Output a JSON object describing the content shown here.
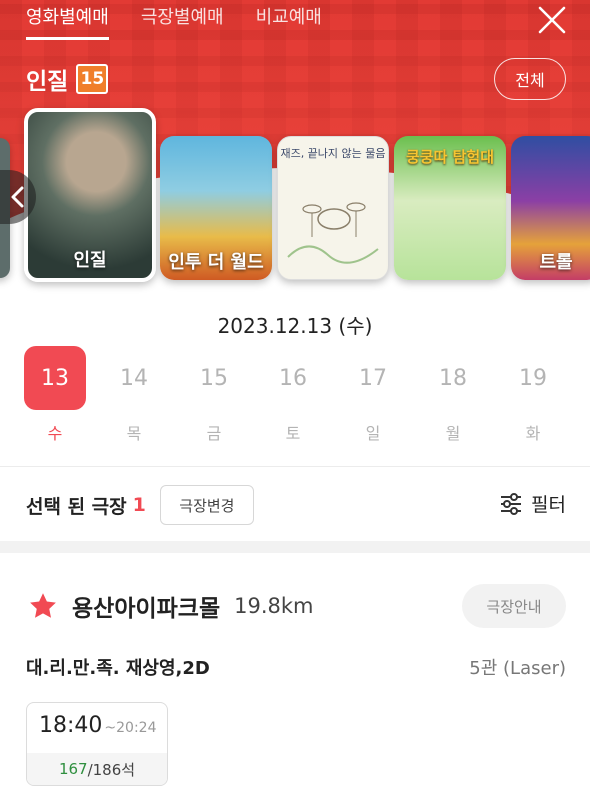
{
  "nav": {
    "tabs": [
      "영화별예매",
      "극장별예매",
      "비교예매"
    ],
    "active_tab": 0
  },
  "movie": {
    "title": "인질",
    "rating": "15",
    "all_button": "전체"
  },
  "posters": [
    {
      "caption": ""
    },
    {
      "caption": "인질"
    },
    {
      "caption": "인투 더 월드"
    },
    {
      "caption": "재즈, 끝나지 않는 물음"
    },
    {
      "caption": "쿵쿵따 탐험대"
    },
    {
      "caption": "트롤"
    }
  ],
  "date": {
    "selected_label": "2023.12.13 (수)",
    "days": [
      {
        "num": "13",
        "dow": "수"
      },
      {
        "num": "14",
        "dow": "목"
      },
      {
        "num": "15",
        "dow": "금"
      },
      {
        "num": "16",
        "dow": "토"
      },
      {
        "num": "17",
        "dow": "일"
      },
      {
        "num": "18",
        "dow": "월"
      },
      {
        "num": "19",
        "dow": "화"
      }
    ]
  },
  "theater_select": {
    "label": "선택 된 극장",
    "count": "1",
    "change_button": "극장변경",
    "filter_label": "필터"
  },
  "cinema": {
    "name": "용산아이파크몰",
    "distance": "19.8km",
    "info_button": "극장안내"
  },
  "showing": {
    "movie_name": "대.리.만.족. 재상영,2D",
    "screen": "5관 (Laser)",
    "slots": [
      {
        "start": "18:40",
        "end": "~20:24",
        "available": "167",
        "total": "/186석"
      }
    ]
  },
  "colors": {
    "header_red": "#e23a34",
    "accent": "#f14a53",
    "rating_orange": "#f07e2b",
    "seats_green": "#2f8f3f"
  },
  "icons": [
    "close-icon",
    "chevron-left-icon",
    "filter-icon",
    "star-icon"
  ]
}
